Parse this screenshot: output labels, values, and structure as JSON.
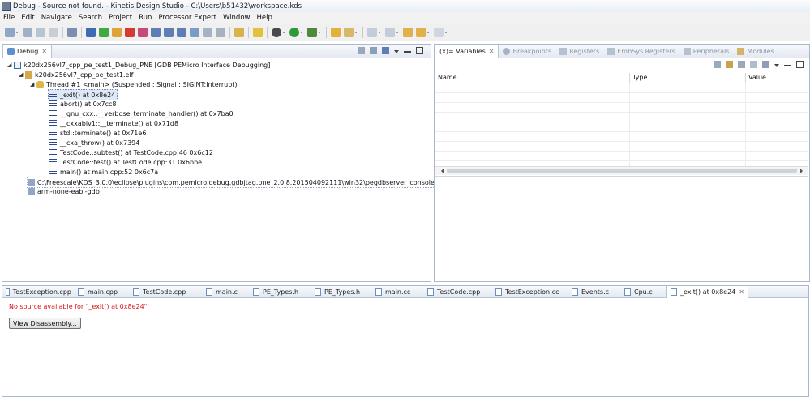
{
  "window": {
    "title": "Debug - Source not found. - Kinetis Design Studio - C:\\Users\\b51432\\workspace.kds"
  },
  "menu": [
    "File",
    "Edit",
    "Navigate",
    "Search",
    "Project",
    "Run",
    "Processor Expert",
    "Window",
    "Help"
  ],
  "debug_view": {
    "tab_label": "Debug",
    "tree": [
      {
        "label": "k20dx256vl7_cpp_pe_test1_Debug_PNE [GDB PEMicro Interface Debugging]",
        "icon": "launch-icon"
      },
      {
        "label": "k20dx256vl7_cpp_pe_test1.elf",
        "icon": "elf-icon"
      },
      {
        "label": "Thread #1 <main> (Suspended : Signal : SIGINT:Interrupt)",
        "icon": "thread-icon"
      },
      {
        "label": "_exit() at 0x8e24",
        "icon": "stack-frame-icon",
        "selected": true
      },
      {
        "label": "abort() at 0x7cc8",
        "icon": "stack-frame-icon"
      },
      {
        "label": "__gnu_cxx::__verbose_terminate_handler() at 0x7ba0",
        "icon": "stack-frame-icon"
      },
      {
        "label": "__cxxabiv1::__terminate() at 0x71d8",
        "icon": "stack-frame-icon"
      },
      {
        "label": "std::terminate() at 0x71e6",
        "icon": "stack-frame-icon"
      },
      {
        "label": "__cxa_throw() at 0x7394",
        "icon": "stack-frame-icon"
      },
      {
        "label": "TestCode::subtest() at TestCode.cpp:46 0x6c12",
        "icon": "stack-frame-icon"
      },
      {
        "label": "TestCode::test() at TestCode.cpp:31 0x6bbe",
        "icon": "stack-frame-icon"
      },
      {
        "label": "main() at main.cpp:52 0x6c7a",
        "icon": "stack-frame-icon"
      },
      {
        "label": "C:\\Freescale\\KDS_3.0.0\\eclipse\\plugins\\com.pemicro.debug.gdbjtag.pne_2.0.8.201504092111\\win32\\pegdbserver_console",
        "icon": "process-icon"
      },
      {
        "label": "arm-none-eabi-gdb",
        "icon": "process-icon"
      }
    ]
  },
  "variables_view": {
    "tabs": [
      {
        "label": "(x)= Variables",
        "active": true
      },
      {
        "label": "Breakpoints"
      },
      {
        "label": "Registers"
      },
      {
        "label": "EmbSys Registers"
      },
      {
        "label": "Peripherals"
      },
      {
        "label": "Modules"
      }
    ],
    "columns": [
      "Name",
      "Type",
      "Value"
    ]
  },
  "editor": {
    "tabs": [
      "TestException.cpp",
      "main.cpp",
      "TestCode.cpp",
      "main.c",
      "PE_Types.h",
      "PE_Types.h",
      "main.cc",
      "TestCode.cpp",
      "TestException.cc",
      "Events.c",
      "Cpu.c",
      "_exit() at 0x8e24"
    ],
    "active_tab": "_exit() at 0x8e24",
    "message": "No source available for \"_exit() at 0x8e24\"",
    "button": "View Disassembly..."
  },
  "colors": {
    "error_text": "#d6141c",
    "selection": "#dfe8f6",
    "panel_border": "#a9b8cb"
  }
}
